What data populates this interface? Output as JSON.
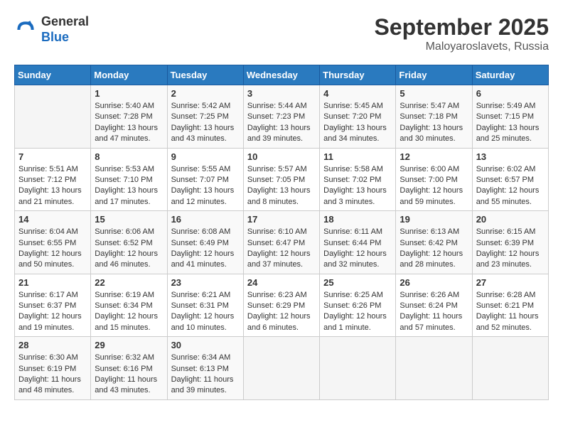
{
  "header": {
    "logo_general": "General",
    "logo_blue": "Blue",
    "month_title": "September 2025",
    "location": "Maloyaroslavets, Russia"
  },
  "days_of_week": [
    "Sunday",
    "Monday",
    "Tuesday",
    "Wednesday",
    "Thursday",
    "Friday",
    "Saturday"
  ],
  "weeks": [
    [
      {
        "day": "",
        "sunrise": "",
        "sunset": "",
        "daylight": ""
      },
      {
        "day": "1",
        "sunrise": "Sunrise: 5:40 AM",
        "sunset": "Sunset: 7:28 PM",
        "daylight": "Daylight: 13 hours and 47 minutes."
      },
      {
        "day": "2",
        "sunrise": "Sunrise: 5:42 AM",
        "sunset": "Sunset: 7:25 PM",
        "daylight": "Daylight: 13 hours and 43 minutes."
      },
      {
        "day": "3",
        "sunrise": "Sunrise: 5:44 AM",
        "sunset": "Sunset: 7:23 PM",
        "daylight": "Daylight: 13 hours and 39 minutes."
      },
      {
        "day": "4",
        "sunrise": "Sunrise: 5:45 AM",
        "sunset": "Sunset: 7:20 PM",
        "daylight": "Daylight: 13 hours and 34 minutes."
      },
      {
        "day": "5",
        "sunrise": "Sunrise: 5:47 AM",
        "sunset": "Sunset: 7:18 PM",
        "daylight": "Daylight: 13 hours and 30 minutes."
      },
      {
        "day": "6",
        "sunrise": "Sunrise: 5:49 AM",
        "sunset": "Sunset: 7:15 PM",
        "daylight": "Daylight: 13 hours and 25 minutes."
      }
    ],
    [
      {
        "day": "7",
        "sunrise": "Sunrise: 5:51 AM",
        "sunset": "Sunset: 7:12 PM",
        "daylight": "Daylight: 13 hours and 21 minutes."
      },
      {
        "day": "8",
        "sunrise": "Sunrise: 5:53 AM",
        "sunset": "Sunset: 7:10 PM",
        "daylight": "Daylight: 13 hours and 17 minutes."
      },
      {
        "day": "9",
        "sunrise": "Sunrise: 5:55 AM",
        "sunset": "Sunset: 7:07 PM",
        "daylight": "Daylight: 13 hours and 12 minutes."
      },
      {
        "day": "10",
        "sunrise": "Sunrise: 5:57 AM",
        "sunset": "Sunset: 7:05 PM",
        "daylight": "Daylight: 13 hours and 8 minutes."
      },
      {
        "day": "11",
        "sunrise": "Sunrise: 5:58 AM",
        "sunset": "Sunset: 7:02 PM",
        "daylight": "Daylight: 13 hours and 3 minutes."
      },
      {
        "day": "12",
        "sunrise": "Sunrise: 6:00 AM",
        "sunset": "Sunset: 7:00 PM",
        "daylight": "Daylight: 12 hours and 59 minutes."
      },
      {
        "day": "13",
        "sunrise": "Sunrise: 6:02 AM",
        "sunset": "Sunset: 6:57 PM",
        "daylight": "Daylight: 12 hours and 55 minutes."
      }
    ],
    [
      {
        "day": "14",
        "sunrise": "Sunrise: 6:04 AM",
        "sunset": "Sunset: 6:55 PM",
        "daylight": "Daylight: 12 hours and 50 minutes."
      },
      {
        "day": "15",
        "sunrise": "Sunrise: 6:06 AM",
        "sunset": "Sunset: 6:52 PM",
        "daylight": "Daylight: 12 hours and 46 minutes."
      },
      {
        "day": "16",
        "sunrise": "Sunrise: 6:08 AM",
        "sunset": "Sunset: 6:49 PM",
        "daylight": "Daylight: 12 hours and 41 minutes."
      },
      {
        "day": "17",
        "sunrise": "Sunrise: 6:10 AM",
        "sunset": "Sunset: 6:47 PM",
        "daylight": "Daylight: 12 hours and 37 minutes."
      },
      {
        "day": "18",
        "sunrise": "Sunrise: 6:11 AM",
        "sunset": "Sunset: 6:44 PM",
        "daylight": "Daylight: 12 hours and 32 minutes."
      },
      {
        "day": "19",
        "sunrise": "Sunrise: 6:13 AM",
        "sunset": "Sunset: 6:42 PM",
        "daylight": "Daylight: 12 hours and 28 minutes."
      },
      {
        "day": "20",
        "sunrise": "Sunrise: 6:15 AM",
        "sunset": "Sunset: 6:39 PM",
        "daylight": "Daylight: 12 hours and 23 minutes."
      }
    ],
    [
      {
        "day": "21",
        "sunrise": "Sunrise: 6:17 AM",
        "sunset": "Sunset: 6:37 PM",
        "daylight": "Daylight: 12 hours and 19 minutes."
      },
      {
        "day": "22",
        "sunrise": "Sunrise: 6:19 AM",
        "sunset": "Sunset: 6:34 PM",
        "daylight": "Daylight: 12 hours and 15 minutes."
      },
      {
        "day": "23",
        "sunrise": "Sunrise: 6:21 AM",
        "sunset": "Sunset: 6:31 PM",
        "daylight": "Daylight: 12 hours and 10 minutes."
      },
      {
        "day": "24",
        "sunrise": "Sunrise: 6:23 AM",
        "sunset": "Sunset: 6:29 PM",
        "daylight": "Daylight: 12 hours and 6 minutes."
      },
      {
        "day": "25",
        "sunrise": "Sunrise: 6:25 AM",
        "sunset": "Sunset: 6:26 PM",
        "daylight": "Daylight: 12 hours and 1 minute."
      },
      {
        "day": "26",
        "sunrise": "Sunrise: 6:26 AM",
        "sunset": "Sunset: 6:24 PM",
        "daylight": "Daylight: 11 hours and 57 minutes."
      },
      {
        "day": "27",
        "sunrise": "Sunrise: 6:28 AM",
        "sunset": "Sunset: 6:21 PM",
        "daylight": "Daylight: 11 hours and 52 minutes."
      }
    ],
    [
      {
        "day": "28",
        "sunrise": "Sunrise: 6:30 AM",
        "sunset": "Sunset: 6:19 PM",
        "daylight": "Daylight: 11 hours and 48 minutes."
      },
      {
        "day": "29",
        "sunrise": "Sunrise: 6:32 AM",
        "sunset": "Sunset: 6:16 PM",
        "daylight": "Daylight: 11 hours and 43 minutes."
      },
      {
        "day": "30",
        "sunrise": "Sunrise: 6:34 AM",
        "sunset": "Sunset: 6:13 PM",
        "daylight": "Daylight: 11 hours and 39 minutes."
      },
      {
        "day": "",
        "sunrise": "",
        "sunset": "",
        "daylight": ""
      },
      {
        "day": "",
        "sunrise": "",
        "sunset": "",
        "daylight": ""
      },
      {
        "day": "",
        "sunrise": "",
        "sunset": "",
        "daylight": ""
      },
      {
        "day": "",
        "sunrise": "",
        "sunset": "",
        "daylight": ""
      }
    ]
  ]
}
